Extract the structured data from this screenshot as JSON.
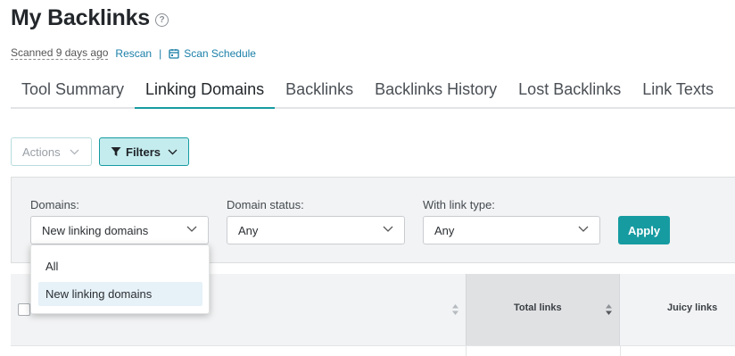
{
  "header": {
    "title": "My Backlinks",
    "help_icon": "?",
    "scanned": "Scanned 9 days ago",
    "rescan": "Rescan",
    "separator": "|",
    "scan_schedule": "Scan Schedule"
  },
  "tabs": [
    {
      "label": "Tool Summary",
      "active": false
    },
    {
      "label": "Linking Domains",
      "active": true
    },
    {
      "label": "Backlinks",
      "active": false
    },
    {
      "label": "Backlinks History",
      "active": false
    },
    {
      "label": "Lost Backlinks",
      "active": false
    },
    {
      "label": "Link Texts",
      "active": false
    }
  ],
  "toolbar": {
    "actions_label": "Actions",
    "filters_label": "Filters"
  },
  "filters": {
    "domains_label": "Domains:",
    "domains_value": "New linking domains",
    "status_label": "Domain status:",
    "status_value": "Any",
    "link_type_label": "With link type:",
    "link_type_value": "Any",
    "apply_label": "Apply"
  },
  "dropdown": {
    "options": [
      "All",
      "New linking domains"
    ],
    "selected": "New linking domains"
  },
  "table": {
    "headers": [
      "Total links",
      "Juicy links"
    ]
  },
  "colors": {
    "accent": "#169ba1",
    "link": "#1a7fa8",
    "filters_bg": "#c4ecee",
    "selected_option_bg": "#e6f1f8"
  }
}
